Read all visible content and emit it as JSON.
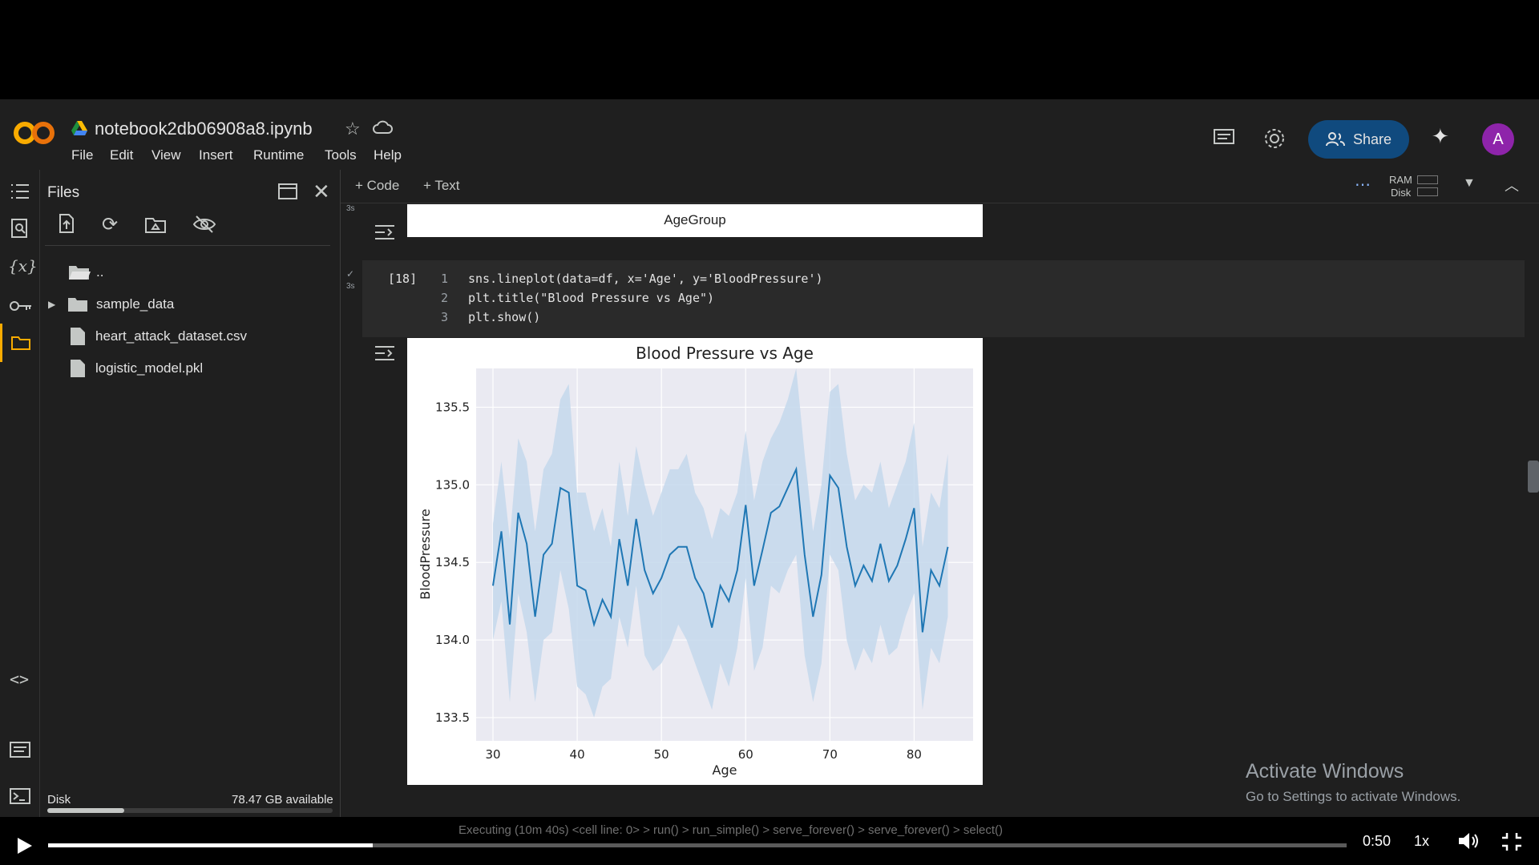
{
  "app": {
    "notebook_title": "notebook2db06908a8.ipynb",
    "logo_text": "CO",
    "avatar_letter": "A",
    "share_label": "Share",
    "menu": [
      "File",
      "Edit",
      "View",
      "Insert",
      "Runtime",
      "Tools",
      "Help"
    ]
  },
  "toolbar": {
    "add_code": "+ Code",
    "add_text": "+ Text",
    "ram_label": "RAM",
    "disk_label": "Disk"
  },
  "files": {
    "title": "Files",
    "items": [
      {
        "name": "..",
        "type": "parent"
      },
      {
        "name": "sample_data",
        "type": "folder"
      },
      {
        "name": "heart_attack_dataset.csv",
        "type": "file"
      },
      {
        "name": "logistic_model.pkl",
        "type": "file"
      }
    ],
    "disk_label": "Disk",
    "disk_available": "78.47 GB available",
    "disk_usage_fraction": 0.27
  },
  "cells": {
    "prev_output_xlabel": "AgeGroup",
    "exec_count": "[18]",
    "exec_time": "3s",
    "code_lines": [
      "sns.lineplot(data=df, x='Age', y='BloodPressure')",
      "plt.title(\"Blood Pressure vs Age\")",
      "plt.show()"
    ]
  },
  "chart_data": {
    "type": "line",
    "title": "Blood Pressure vs Age",
    "xlabel": "Age",
    "ylabel": "BloodPressure",
    "xlim": [
      28,
      87
    ],
    "ylim": [
      133.35,
      135.75
    ],
    "xticks": [
      30,
      40,
      50,
      60,
      70,
      80
    ],
    "yticks": [
      133.5,
      134.0,
      134.5,
      135.0,
      135.5
    ],
    "ytick_labels": [
      "133.5",
      "134.0",
      "134.5",
      "135.0",
      "135.5"
    ],
    "grid": true,
    "line_color": "#1f77b4",
    "band_color": "#c4d8ec",
    "x": [
      30,
      31,
      32,
      33,
      34,
      35,
      36,
      37,
      38,
      39,
      40,
      41,
      42,
      43,
      44,
      45,
      46,
      47,
      48,
      49,
      50,
      51,
      52,
      53,
      54,
      55,
      56,
      57,
      58,
      59,
      60,
      61,
      62,
      63,
      64,
      65,
      66,
      67,
      68,
      69,
      70,
      71,
      72,
      73,
      74,
      75,
      76,
      77,
      78,
      79,
      80,
      81,
      82,
      83,
      84
    ],
    "y": [
      134.35,
      134.7,
      134.1,
      134.82,
      134.62,
      134.15,
      134.55,
      134.62,
      134.98,
      134.95,
      134.35,
      134.32,
      134.1,
      134.26,
      134.15,
      134.65,
      134.35,
      134.78,
      134.45,
      134.3,
      134.4,
      134.55,
      134.6,
      134.6,
      134.4,
      134.3,
      134.08,
      134.35,
      134.25,
      134.45,
      134.87,
      134.35,
      134.58,
      134.82,
      134.86,
      134.98,
      135.1,
      134.55,
      134.15,
      134.42,
      135.06,
      134.98,
      134.6,
      134.35,
      134.48,
      134.38,
      134.62,
      134.38,
      134.48,
      134.65,
      134.85,
      134.05,
      134.45,
      134.35,
      134.6
    ],
    "y_lower": [
      134.0,
      134.25,
      133.6,
      134.3,
      134.05,
      133.6,
      134.0,
      134.05,
      134.45,
      134.2,
      133.7,
      133.65,
      133.5,
      133.7,
      133.75,
      134.15,
      133.95,
      134.35,
      133.9,
      133.8,
      133.85,
      133.95,
      134.1,
      134.0,
      133.85,
      133.7,
      133.55,
      133.85,
      133.7,
      133.95,
      134.4,
      133.8,
      133.95,
      134.35,
      134.3,
      134.45,
      134.55,
      133.9,
      133.6,
      133.85,
      134.55,
      134.45,
      134.0,
      133.8,
      133.95,
      133.85,
      134.1,
      133.9,
      133.95,
      134.15,
      134.3,
      133.55,
      133.95,
      133.85,
      134.15
    ],
    "y_upper": [
      134.75,
      135.15,
      134.65,
      135.3,
      135.15,
      134.7,
      135.1,
      135.2,
      135.55,
      135.65,
      134.95,
      134.95,
      134.7,
      134.85,
      134.6,
      135.15,
      134.8,
      135.25,
      135.0,
      134.8,
      134.95,
      135.1,
      135.1,
      135.2,
      134.95,
      134.85,
      134.65,
      134.85,
      134.8,
      134.95,
      135.35,
      134.9,
      135.15,
      135.3,
      135.4,
      135.55,
      135.75,
      135.2,
      134.7,
      135.0,
      135.6,
      135.65,
      135.2,
      134.9,
      135.0,
      134.95,
      135.15,
      134.85,
      135.0,
      135.15,
      135.4,
      134.6,
      134.95,
      134.85,
      135.2
    ]
  },
  "windows_overlay": {
    "line1": "Activate Windows",
    "line2": "Go to Settings to activate Windows."
  },
  "status": {
    "executing": "Executing (10m 40s)  <cell line: 0> > run() > run_simple() > serve_forever() > serve_forever() > select()"
  },
  "video": {
    "time": "0:50",
    "speed": "1x",
    "progress_fraction": 0.25
  }
}
